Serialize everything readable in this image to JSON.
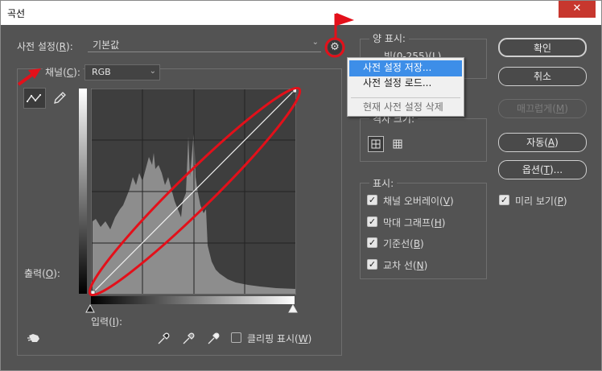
{
  "window": {
    "title": "곡선",
    "close_icon": "close-icon"
  },
  "preset": {
    "label": "사전 설정(",
    "key": "R",
    "label_end": "):",
    "value": "기본값"
  },
  "channel": {
    "label": "채널(",
    "key": "C",
    "label_end": "):",
    "value": "RGB"
  },
  "tools": {
    "curve": "curve-point-tool-icon",
    "pencil": "pencil-icon"
  },
  "output_label": {
    "label": "출력(",
    "key": "O",
    "label_end": "):"
  },
  "input_label": {
    "label": "입력(",
    "key": "I",
    "label_end": "):"
  },
  "clipping": {
    "label": "클리핑 표시(",
    "key": "W",
    "label_end": ")",
    "checked": false
  },
  "amount_group": {
    "legend": "양 표시:",
    "option_light": "빛(0-255)(L)"
  },
  "grid_group": {
    "legend": "격자 크기:"
  },
  "display_group": {
    "legend": "표시:",
    "options": [
      {
        "label": "채널 오버레이(",
        "key": "V",
        "end": ")",
        "checked": true
      },
      {
        "label": "막대 그래프(",
        "key": "H",
        "end": ")",
        "checked": true
      },
      {
        "label": "기준선(",
        "key": "B",
        "end": ")",
        "checked": true
      },
      {
        "label": "교차 선(",
        "key": "N",
        "end": ")",
        "checked": true
      }
    ]
  },
  "buttons": {
    "ok": "확인",
    "cancel": "취소",
    "smooth": {
      "label": "매끄럽게(",
      "key": "M",
      "end": ")"
    },
    "auto": {
      "label": "자동(",
      "key": "A",
      "end": ")"
    },
    "options": {
      "label": "옵션(",
      "key": "T",
      "end": ")..."
    }
  },
  "preview": {
    "label": "미리 보기(",
    "key": "P",
    "end": ")",
    "checked": true
  },
  "preset_menu": {
    "items": [
      "사전 설정 저장...",
      "사전 설정 로드...",
      "현재 사전 설정 삭제"
    ],
    "highlighted": 0
  },
  "colors": {
    "annotation_red": "#e3101a",
    "menu_highlight": "#3d8ee8",
    "panel_bg": "#535353"
  }
}
